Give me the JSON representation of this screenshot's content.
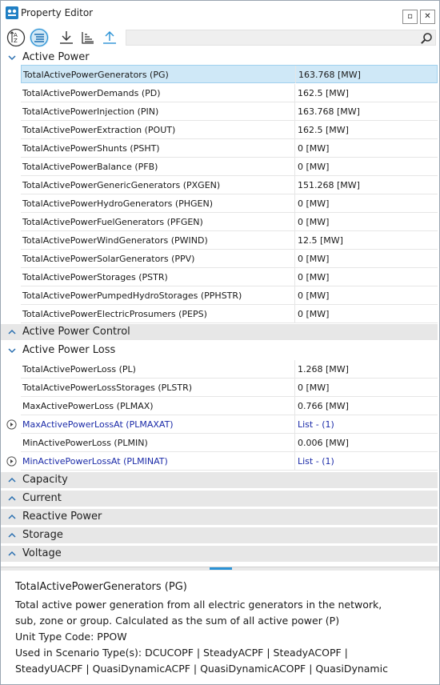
{
  "window": {
    "title": "Property Editor",
    "maximize_glyph": "▫",
    "close_glyph": "✕"
  },
  "icons": {
    "app": "property-editor-app-icon",
    "sort_az": "sort-alphabetical-icon",
    "categorized": "categorized-view-icon",
    "collapse_all": "collapse-download-icon",
    "sort_bars": "sort-bars-icon",
    "export": "export-upload-icon",
    "search": "search-icon"
  },
  "search": {
    "value": "",
    "placeholder": ""
  },
  "categories": {
    "active_power": "Active Power",
    "active_power_control": "Active Power Control",
    "active_power_loss": "Active Power Loss",
    "capacity": "Capacity",
    "current": "Current",
    "reactive_power": "Reactive Power",
    "storage": "Storage",
    "voltage": "Voltage"
  },
  "active_power_rows": [
    {
      "name": "TotalActivePowerGenerators (PG)",
      "value": "163.768 [MW]"
    },
    {
      "name": "TotalActivePowerDemands (PD)",
      "value": "162.5 [MW]"
    },
    {
      "name": "TotalActivePowerInjection (PIN)",
      "value": "163.768 [MW]"
    },
    {
      "name": "TotalActivePowerExtraction (POUT)",
      "value": "162.5 [MW]"
    },
    {
      "name": "TotalActivePowerShunts (PSHT)",
      "value": "0 [MW]"
    },
    {
      "name": "TotalActivePowerBalance (PFB)",
      "value": "0 [MW]"
    },
    {
      "name": "TotalActivePowerGenericGenerators (PXGEN)",
      "value": "151.268 [MW]"
    },
    {
      "name": "TotalActivePowerHydroGenerators (PHGEN)",
      "value": "0 [MW]"
    },
    {
      "name": "TotalActivePowerFuelGenerators (PFGEN)",
      "value": "0 [MW]"
    },
    {
      "name": "TotalActivePowerWindGenerators (PWIND)",
      "value": "12.5 [MW]"
    },
    {
      "name": "TotalActivePowerSolarGenerators (PPV)",
      "value": "0 [MW]"
    },
    {
      "name": "TotalActivePowerStorages (PSTR)",
      "value": "0 [MW]"
    },
    {
      "name": "TotalActivePowerPumpedHydroStorages (PPHSTR)",
      "value": "0 [MW]"
    },
    {
      "name": "TotalActivePowerElectricProsumers (PEPS)",
      "value": "0 [MW]"
    }
  ],
  "active_power_loss_rows": [
    {
      "name": "TotalActivePowerLoss (PL)",
      "value": "1.268 [MW]"
    },
    {
      "name": "TotalActivePowerLossStorages (PLSTR)",
      "value": "0 [MW]"
    },
    {
      "name": "MaxActivePowerLoss (PLMAX)",
      "value": "0.766 [MW]"
    },
    {
      "name": "MaxActivePowerLossAt (PLMAXAT)",
      "value": "List - (1)"
    },
    {
      "name": "MinActivePowerLoss (PLMIN)",
      "value": "0.006 [MW]"
    },
    {
      "name": "MinActivePowerLossAt (PLMINAT)",
      "value": "List - (1)"
    }
  ],
  "description": {
    "title": "TotalActivePowerGenerators (PG)",
    "lines": [
      "Total active power generation from all electric generators in the network,",
      "sub, zone or group. Calculated as the sum of all active power (P)",
      "Unit Type Code: PPOW",
      "Used in Scenario Type(s):  DCUCOPF | SteadyACPF | SteadyACOPF |",
      "SteadyUACPF  |  QuasiDynamicACPF  |  QuasiDynamicACOPF  | QuasiDynamic"
    ]
  },
  "colors": {
    "accent": "#2a92d6",
    "selection": "#cfe8f7",
    "link_text": "#1a2aa8",
    "category_bg": "#e7e7e7"
  }
}
